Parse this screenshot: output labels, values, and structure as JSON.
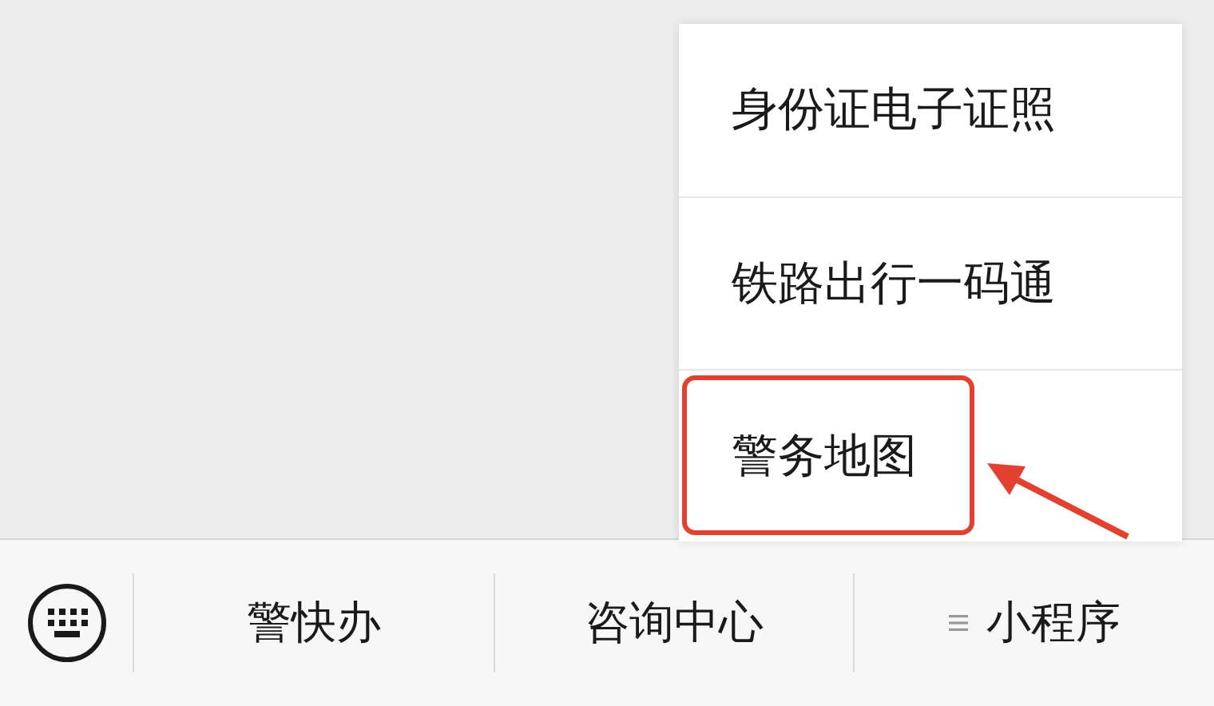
{
  "popup_menu": {
    "items": [
      {
        "label": "身份证电子证照",
        "highlighted": false
      },
      {
        "label": "铁路出行一码通",
        "highlighted": false
      },
      {
        "label": "警务地图",
        "highlighted": true
      }
    ]
  },
  "bottom_menu": {
    "items": [
      {
        "label": "警快办",
        "kind": "plain"
      },
      {
        "label": "咨询中心",
        "kind": "plain"
      },
      {
        "label": "小程序",
        "kind": "submenu"
      }
    ]
  }
}
